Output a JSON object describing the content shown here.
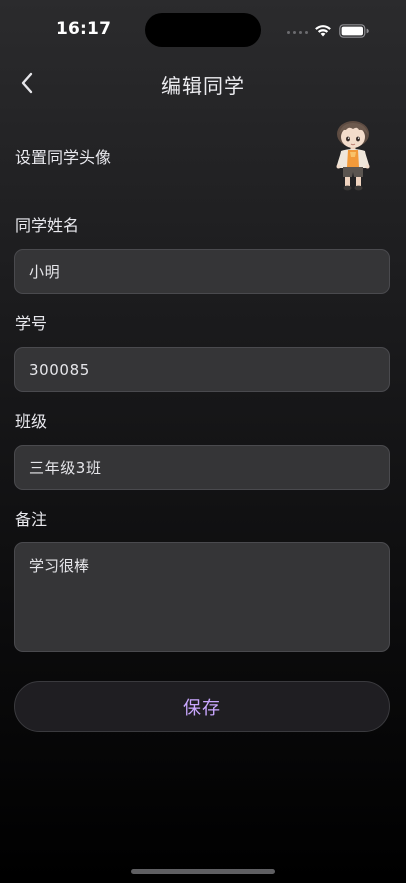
{
  "status_bar": {
    "time": "16:17",
    "icons": [
      "signal-dots-icon",
      "wifi-icon",
      "battery-icon"
    ]
  },
  "nav": {
    "back_icon": "chevron-left-icon",
    "title": "编辑同学"
  },
  "form": {
    "avatar_label": "设置同学头像",
    "name": {
      "label": "同学姓名",
      "value": "小明"
    },
    "student_id": {
      "label": "学号",
      "value": "300085"
    },
    "class": {
      "label": "班级",
      "value": "三年级3班"
    },
    "note": {
      "label": "备注",
      "value": "学习很棒"
    }
  },
  "actions": {
    "save_label": "保存"
  },
  "colors": {
    "accent": "#c9a7ff",
    "input_bg": "#353537",
    "text": "#e9e9ee"
  }
}
